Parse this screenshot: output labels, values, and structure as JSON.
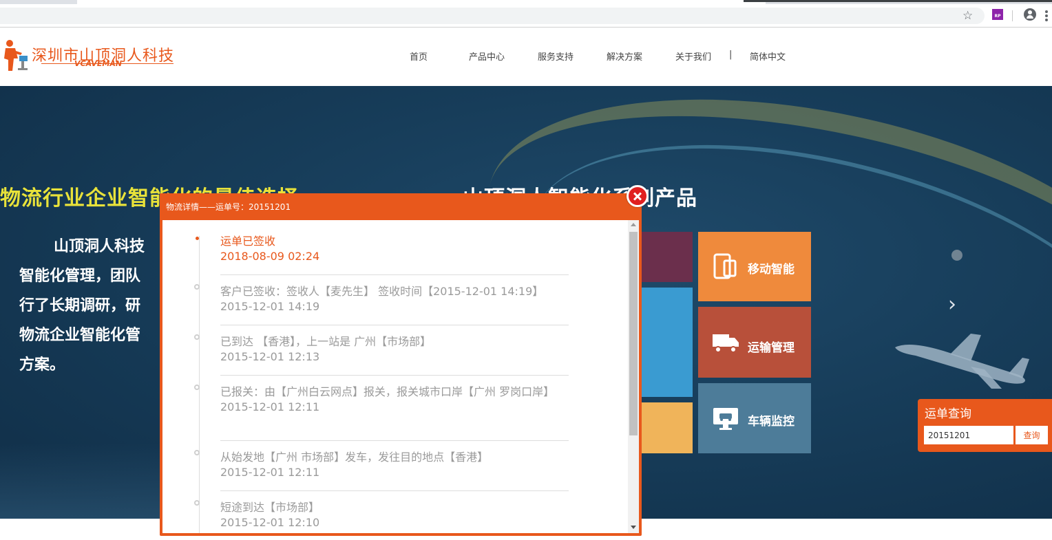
{
  "browser": {
    "bookmark_icon": "star-icon",
    "extension_label": "RP",
    "account_icon": "account-icon"
  },
  "site": {
    "logo_cn": "深圳市山顶洞人科技",
    "logo_en": "VCAVEMAN",
    "nav": [
      {
        "label": "首页"
      },
      {
        "label": "产品中心"
      },
      {
        "label": "服务支持"
      },
      {
        "label": "解决方案"
      },
      {
        "label": "关于我们"
      },
      {
        "label": "|"
      },
      {
        "label": "简体中文"
      }
    ]
  },
  "hero": {
    "title_left": "物流行业企业智能化的最佳选择",
    "title_right": "山顶洞人智能化系列产品",
    "paragraph_lines": [
      "山顶洞人科技",
      "智能化管理，团队",
      "行了长期调研，研",
      "物流企业智能化管",
      "方案。"
    ],
    "tiles": [
      {
        "label": "移动智能",
        "color": "#ef8a3c",
        "icon": "mobile-icon"
      },
      {
        "label": "运输管理",
        "color": "#b8503a",
        "icon": "truck-icon"
      },
      {
        "label": "车辆监控",
        "color": "#4d7c99",
        "icon": "monitor-car-icon"
      }
    ],
    "next_arrow": "›"
  },
  "waybill_query": {
    "title": "运单查询",
    "input_value": "20151201",
    "button_label": "查询"
  },
  "modal": {
    "title": "物流详情——运单号：20151201",
    "events": [
      {
        "text": "运单已签收",
        "time": "2018-08-09 02:24",
        "active": true
      },
      {
        "text": "客户已签收：签收人【麦先生】 签收时间【2015-12-01 14:19】",
        "time": "2015-12-01 14:19",
        "active": false
      },
      {
        "text": "已到达 【香港】，上一站是 广州【市场部】",
        "time": "2015-12-01 12:13",
        "active": false
      },
      {
        "text": "已报关：由【广州白云网点】报关，报关城市口岸【广州 罗岗口岸】",
        "time": "2015-12-01 12:11",
        "active": false
      },
      {
        "text": "从始发地【广州 市场部】发车，发往目的地点【香港】",
        "time": "2015-12-01 12:11",
        "active": false
      },
      {
        "text": "短途到达【市场部】",
        "time": "2015-12-01 12:10",
        "active": false
      }
    ]
  }
}
